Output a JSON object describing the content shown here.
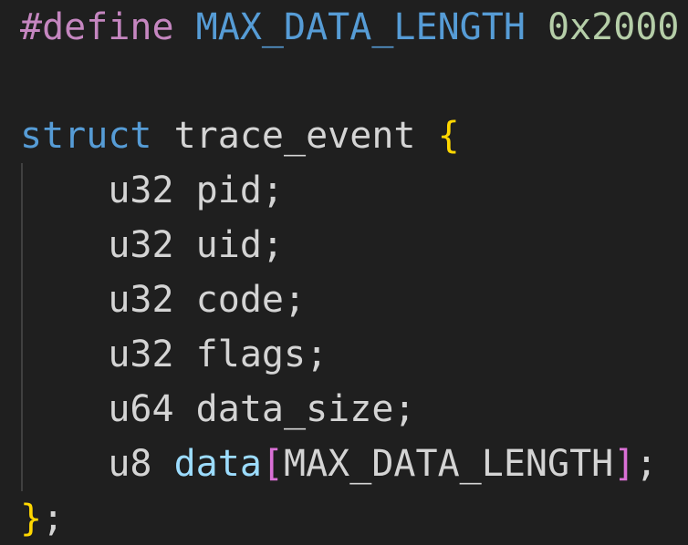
{
  "code": {
    "line1": {
      "directive": "#define",
      "macro": "MAX_DATA_LENGTH",
      "value": "0x2000"
    },
    "line3": {
      "keyword": "struct",
      "name": "trace_event",
      "open_brace": "{"
    },
    "fields": [
      {
        "type": "u32",
        "name": "pid;"
      },
      {
        "type": "u32",
        "name": "uid;"
      },
      {
        "type": "u32",
        "name": "code;"
      },
      {
        "type": "u32",
        "name": "flags;"
      },
      {
        "type": "u64",
        "name": "data_size;"
      }
    ],
    "array_field": {
      "type": "u8",
      "name": "data",
      "open_bracket": "[",
      "size": "MAX_DATA_LENGTH",
      "close_bracket": "]",
      "semicolon": ";"
    },
    "close": {
      "brace": "}",
      "semicolon": ";"
    }
  },
  "colors": {
    "background": "#1f1f1f",
    "preprocessor": "#c586c0",
    "keyword": "#569cd6",
    "number": "#b5cea8",
    "text": "#d4d4d4",
    "brace": "#ffd700",
    "field": "#9cdcfe",
    "bracket": "#da70d6"
  }
}
